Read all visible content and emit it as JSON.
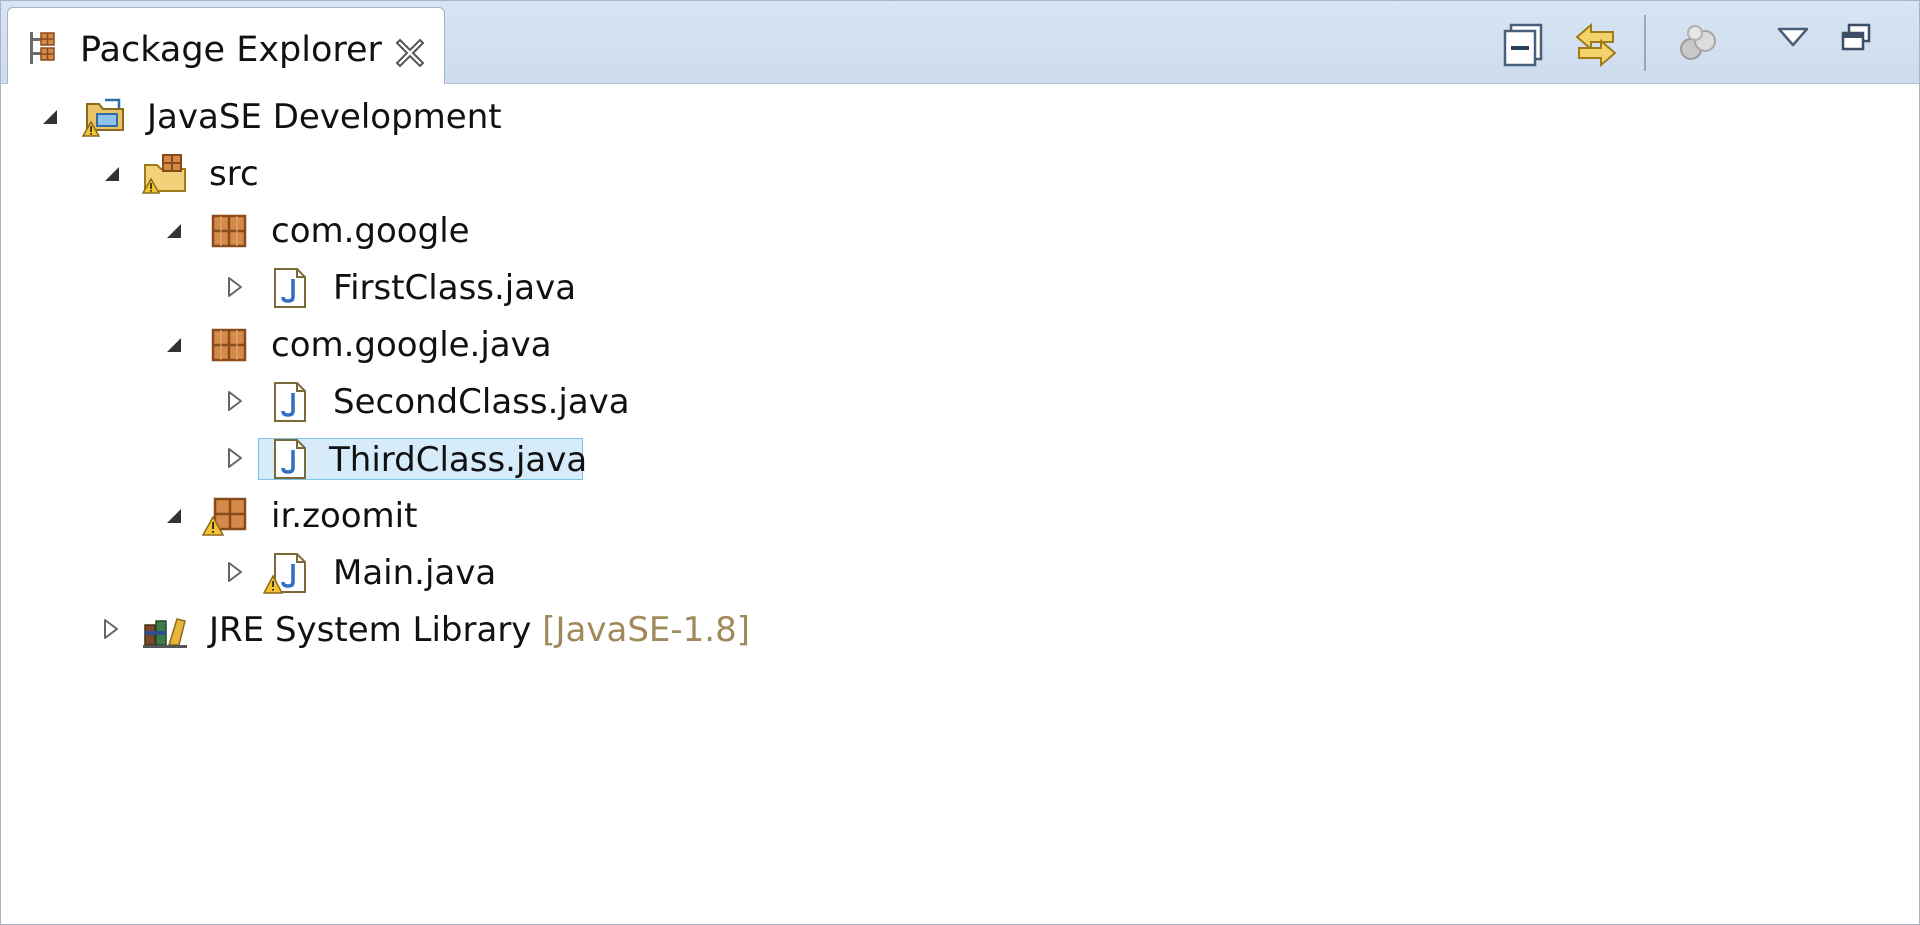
{
  "view": {
    "title": "Package Explorer",
    "tab_icon": "package-explorer-icon",
    "close_icon": "close-icon"
  },
  "toolbar": {
    "buttons": [
      {
        "name": "collapse-all-icon"
      },
      {
        "name": "link-with-editor-icon"
      },
      {
        "name": "select-working-set-icon"
      },
      {
        "name": "view-menu-icon"
      },
      {
        "name": "minimize-icon"
      }
    ]
  },
  "tree": {
    "project": {
      "label": "JavaSE Development",
      "icon": "java-project-icon",
      "expanded": true
    },
    "src": {
      "label": "src",
      "icon": "source-folder-icon",
      "expanded": true
    },
    "pkg1": {
      "label": "com.google",
      "icon": "package-icon",
      "expanded": true
    },
    "file1": {
      "label": "FirstClass.java",
      "icon": "java-file-icon",
      "expanded": false
    },
    "pkg2": {
      "label": "com.google.java",
      "icon": "package-icon",
      "expanded": true
    },
    "file2": {
      "label": "SecondClass.java",
      "icon": "java-file-icon",
      "expanded": false
    },
    "file3": {
      "label": "ThirdClass.java",
      "icon": "java-file-icon",
      "expanded": false,
      "selected": true
    },
    "pkg3": {
      "label": "ir.zoomit",
      "icon": "package-warning-icon",
      "expanded": true
    },
    "file4": {
      "label": "Main.java",
      "icon": "java-file-warning-icon",
      "expanded": false
    },
    "jre": {
      "label": "JRE System Library",
      "qualifier": "[JavaSE-1.8]",
      "icon": "library-icon",
      "expanded": false
    }
  },
  "colors": {
    "selection_bg": "#d6ecfb",
    "selection_border": "#7fc2ea",
    "qualifier_text": "#a08a5b",
    "tabbar_bg": "#d2e0f0"
  }
}
